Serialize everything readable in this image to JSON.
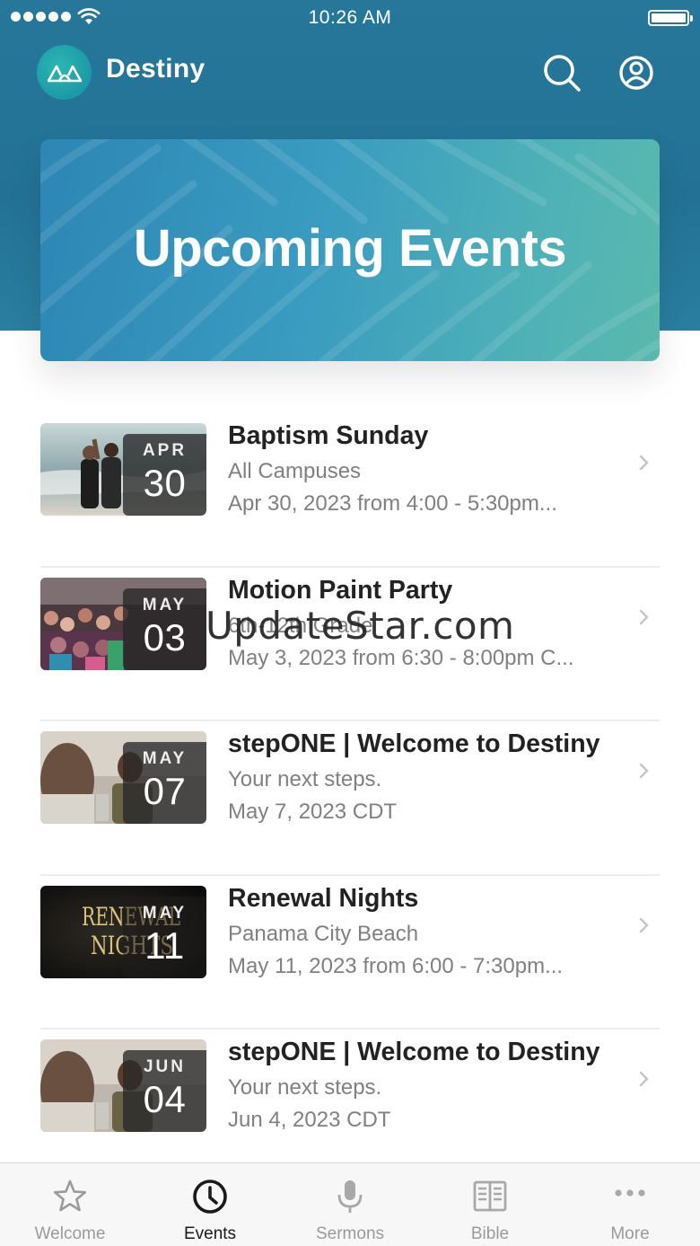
{
  "status_bar": {
    "time": "10:26 AM"
  },
  "app": {
    "title": "Destiny"
  },
  "banner": {
    "title": "Upcoming Events"
  },
  "events": [
    {
      "month": "APR",
      "day": "30",
      "title": "Baptism Sunday",
      "subtitle": "All Campuses",
      "date": "Apr 30, 2023 from 4:00 - 5:30pm..."
    },
    {
      "month": "MAY",
      "day": "03",
      "title": "Motion Paint Party",
      "subtitle": "6th-12th Grade",
      "date": "May 3, 2023 from 6:30 - 8:00pm C..."
    },
    {
      "month": "MAY",
      "day": "07",
      "title": "stepONE | Welcome to Destiny",
      "subtitle": "Your next steps.",
      "date": "May 7, 2023 CDT"
    },
    {
      "month": "MAY",
      "day": "11",
      "title": "Renewal Nights",
      "subtitle": "Panama City Beach",
      "date": "May 11, 2023 from 6:00 - 7:30pm..."
    },
    {
      "month": "JUN",
      "day": "04",
      "title": "stepONE | Welcome to Destiny",
      "subtitle": "Your next steps.",
      "date": "Jun 4, 2023 CDT"
    }
  ],
  "thumb_texts": {
    "renewal_line1": "RENEWAL",
    "renewal_line2": "NIGHTS"
  },
  "watermark": "UpdateStar.com",
  "tabs": [
    {
      "label": "Welcome",
      "icon": "star-icon",
      "active": false
    },
    {
      "label": "Events",
      "icon": "clock-icon",
      "active": true
    },
    {
      "label": "Sermons",
      "icon": "microphone-icon",
      "active": false
    },
    {
      "label": "Bible",
      "icon": "book-icon",
      "active": false
    },
    {
      "label": "More",
      "icon": "more-dots-icon",
      "active": false
    }
  ],
  "colors": {
    "header": "#237296",
    "banner_start": "#2d86b4",
    "banner_end": "#5ab8ad",
    "logo": "#2ab7b4",
    "tab_active": "#1a1a1a",
    "tab_inactive": "#9a9a9a"
  }
}
